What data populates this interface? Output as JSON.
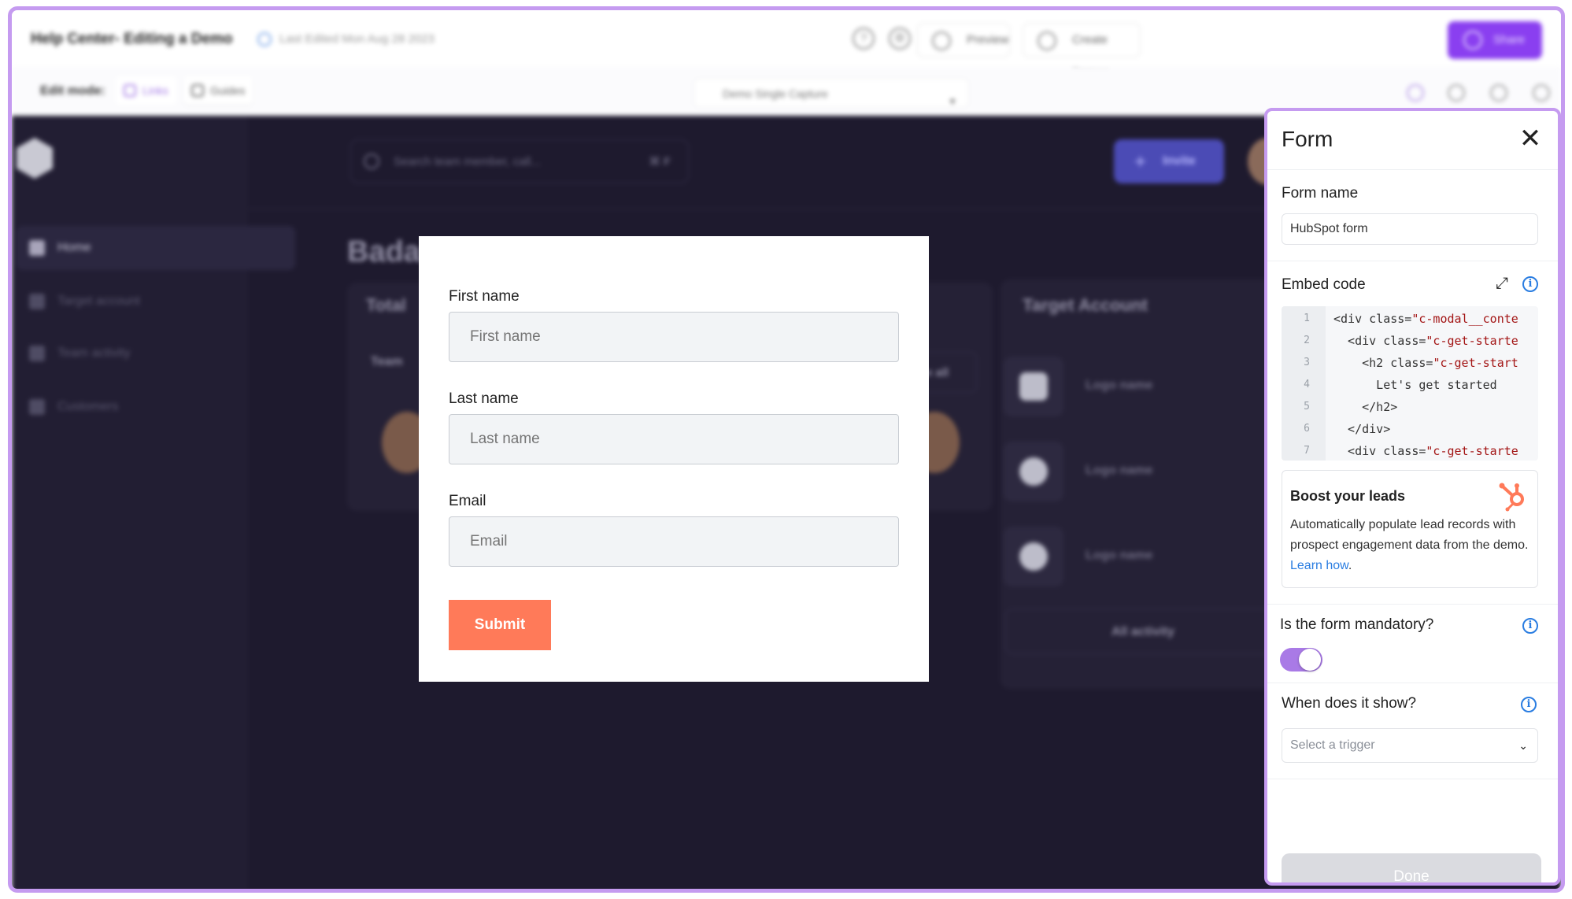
{
  "topbar": {
    "title": "Help Center- Editing a Demo",
    "edited": "Last Edited Mon Aug 28 2023",
    "preview_label": "Preview",
    "create_label": "Create Demos",
    "share_label": "Share"
  },
  "editbar": {
    "mode_label": "Edit mode:",
    "tab_links": "Links",
    "tab_guides": "Guides",
    "demo_select": "Demo Single Capture"
  },
  "app": {
    "nav": [
      "Home",
      "Target account",
      "Team activity",
      "Customers"
    ],
    "search_placeholder": "Search team member, call...",
    "search_shortcut": "⌘ F",
    "invite_label": "Invite",
    "page_title": "Bada",
    "total_label": "Total",
    "team_label": "Team",
    "see_all": "e all",
    "target_account_title": "Target Account",
    "logo_names": [
      "Logo name",
      "Logo name",
      "Logo name"
    ],
    "all_activity": "All activity"
  },
  "form": {
    "first_name_label": "First name",
    "first_name_placeholder": "First name",
    "last_name_label": "Last name",
    "last_name_placeholder": "Last name",
    "email_label": "Email",
    "email_placeholder": "Email",
    "submit_label": "Submit"
  },
  "panel": {
    "title": "Form",
    "close_glyph": "✕",
    "form_name_label": "Form name",
    "form_name_value": "HubSpot form",
    "embed_label": "Embed code",
    "code_lines": [
      {
        "n": "1",
        "pre": "<div class=",
        "str": "\"c-modal__conte"
      },
      {
        "n": "2",
        "pre": "  <div class=",
        "str": "\"c-get-starte"
      },
      {
        "n": "3",
        "pre": "    <h2 class=",
        "str": "\"c-get-start"
      },
      {
        "n": "4",
        "pre": "      Let's get started",
        "str": ""
      },
      {
        "n": "5",
        "pre": "    </h2>",
        "str": ""
      },
      {
        "n": "6",
        "pre": "  </div>",
        "str": ""
      },
      {
        "n": "7",
        "pre": "  <div class=",
        "str": "\"c-get-starte"
      }
    ],
    "boost_title": "Boost your leads",
    "boost_desc": "Automatically populate lead records with prospect engagement data from the demo.",
    "boost_link": "Learn how",
    "boost_end": ".",
    "mandatory_label": "Is the form mandatory?",
    "mandatory_on": true,
    "when_label": "When does it show?",
    "trigger_placeholder": "Select a trigger",
    "done_label": "Done"
  },
  "colors": {
    "accent": "#a97ae6",
    "submit": "#ff7a59",
    "frame": "#c59bf0",
    "info": "#2a7de1",
    "hubspot": "#ff7a59"
  }
}
